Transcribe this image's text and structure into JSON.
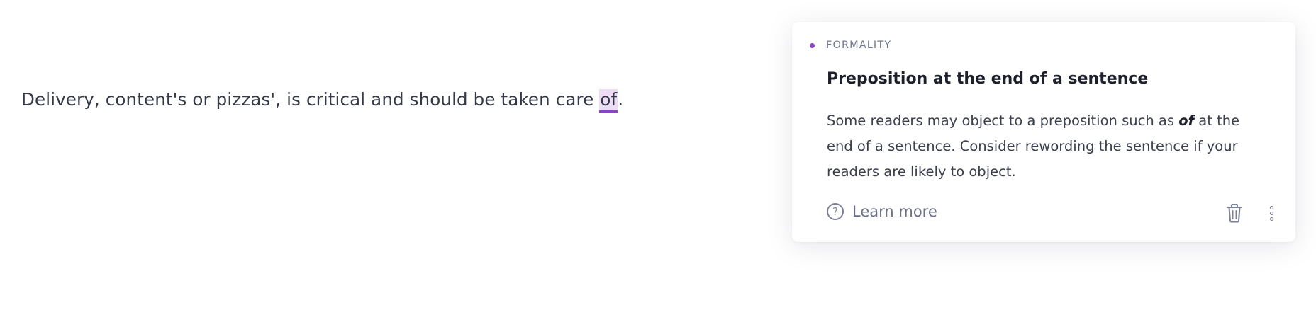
{
  "editor": {
    "text_before": "Delivery, content's or pizzas', is critical and should be taken care ",
    "flagged_word": "of",
    "text_after": "."
  },
  "suggestion_card": {
    "category": "FORMALITY",
    "title": "Preposition at the end of a sentence",
    "description_part1": "Some readers may object to a preposition such as ",
    "description_emphasis": "of",
    "description_part2": " at the end of a sentence. Consider rewording the sentence if your readers are likely to object.",
    "learn_more_label": "Learn more",
    "help_icon_glyph": "?",
    "icons": {
      "help": "question-circle-icon",
      "dismiss": "trash-icon",
      "more": "more-vertical-icon"
    }
  },
  "colors": {
    "accent": "#8a45c2",
    "highlight_bg": "#ecdcf5",
    "muted_text": "#73788f"
  }
}
